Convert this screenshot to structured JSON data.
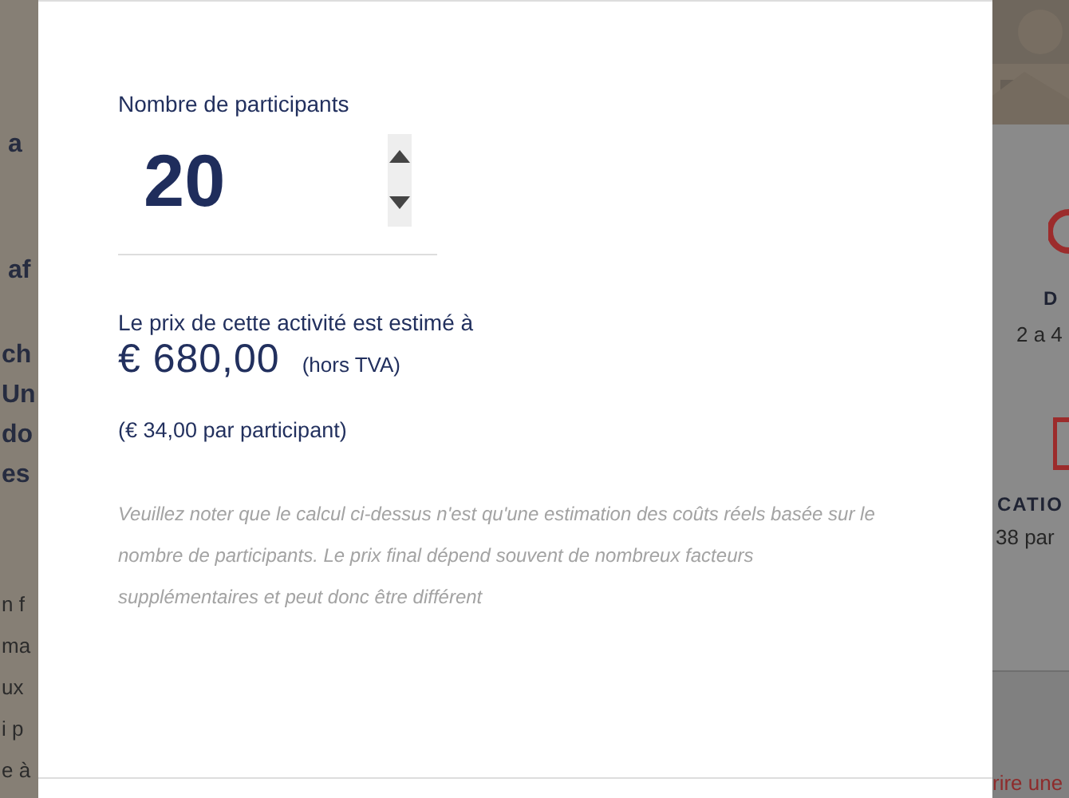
{
  "background_page": {
    "left_groups": [
      {
        "kind": "heading",
        "lines": [
          "a"
        ]
      },
      {
        "kind": "heading",
        "lines": [
          "af"
        ]
      },
      {
        "kind": "heading",
        "lines": [
          "ch",
          "Un",
          "do",
          "es"
        ]
      },
      {
        "kind": "body",
        "lines": [
          "n f",
          "ma",
          "ux",
          "i p",
          "e à"
        ]
      }
    ],
    "right_panel": {
      "duration_label": "D",
      "duration_value": "2 a 4",
      "location_label": "CATIO",
      "location_value": "38 par",
      "link": "rire une"
    }
  },
  "modal": {
    "participants_label": "Nombre de participants",
    "participants_value": "20",
    "price_intro": "Le prix de cette activité est estimé à",
    "price": "€ 680,00",
    "price_note": "(hors TVA)",
    "per_participant": "(€ 34,00 par participant)",
    "disclaimer": "Veuillez noter que le calcul ci-dessus n'est qu'une estimation des coûts réels basée sur le nombre de participants. Le prix final dépend souvent de nombreux facteurs supplémentaires et peut donc être différent"
  }
}
